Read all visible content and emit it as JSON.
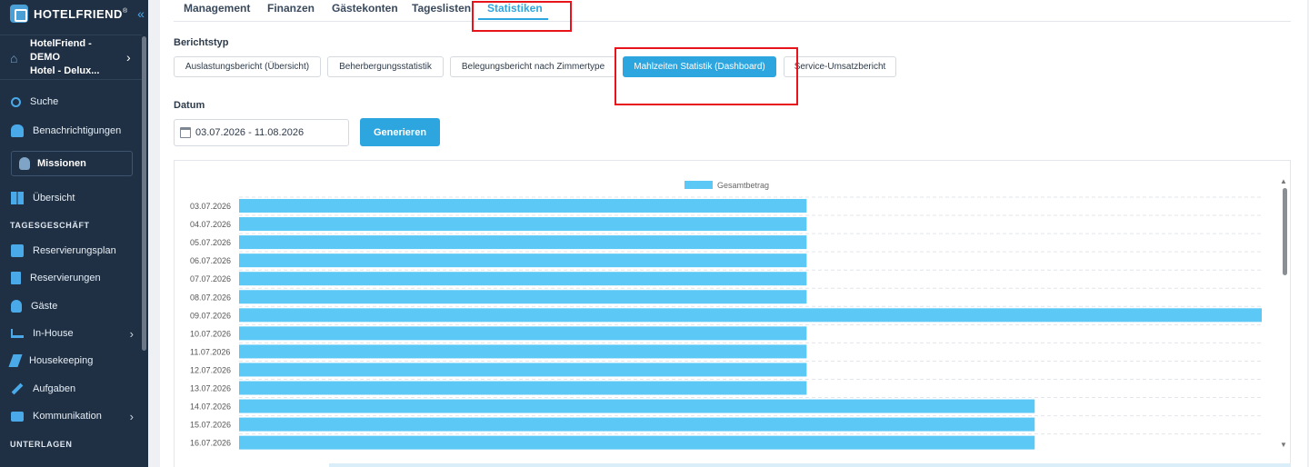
{
  "brand": {
    "name": "HOTELFRIEND",
    "registered": "®",
    "collapse_icon": "double-chevron-left-icon"
  },
  "hotel": {
    "line1": "HotelFriend - DEMO",
    "line2": "Hotel - Delux..."
  },
  "sidebar": {
    "items": [
      {
        "label": "Suche",
        "icon": "search-icon"
      },
      {
        "label": "Benachrichtigungen",
        "icon": "bell-icon"
      },
      {
        "label": "Missionen",
        "icon": "award-icon"
      },
      {
        "label": "Übersicht",
        "icon": "dashboard-icon"
      },
      {
        "label": "Reservierungsplan",
        "icon": "calendar-icon"
      },
      {
        "label": "Reservierungen",
        "icon": "document-icon"
      },
      {
        "label": "Gäste",
        "icon": "user-icon"
      },
      {
        "label": "In-House",
        "icon": "cart-icon"
      },
      {
        "label": "Housekeeping",
        "icon": "broom-icon"
      },
      {
        "label": "Aufgaben",
        "icon": "wrench-icon"
      },
      {
        "label": "Kommunikation",
        "icon": "chat-icon"
      }
    ],
    "section_tagesgeschaeft": "TAGESGESCHÄFT",
    "section_unterlagen": "UNTERLAGEN"
  },
  "tabs": [
    "Management",
    "Finanzen",
    "Gästekonten",
    "Tageslisten",
    "Statistiken"
  ],
  "active_tab": "Statistiken",
  "berichtstyp": {
    "label": "Berichtstyp",
    "options": [
      "Auslastungsbericht (Übersicht)",
      "Beherbergungsstatistik",
      "Belegungsbericht nach Zimmertype",
      "Mahlzeiten Statistik (Dashboard)",
      "Service-Umsatzbericht"
    ],
    "selected": "Mahlzeiten Statistik (Dashboard)"
  },
  "datum": {
    "label": "Datum",
    "value": "03.07.2026 - 11.08.2026"
  },
  "generate_label": "Generieren",
  "colors": {
    "accent": "#2da6e0",
    "bar": "#5bc8f5",
    "sidebar": "#1f3044",
    "highlight": "#e8141c"
  },
  "chart_data": {
    "type": "bar",
    "orientation": "horizontal",
    "legend": [
      "Gesamtbetrag"
    ],
    "legend_position": "top-center",
    "grid": true,
    "categories": [
      "03.07.2026",
      "04.07.2026",
      "05.07.2026",
      "06.07.2026",
      "07.07.2026",
      "08.07.2026",
      "09.07.2026",
      "10.07.2026",
      "11.07.2026",
      "12.07.2026",
      "13.07.2026",
      "14.07.2026",
      "15.07.2026",
      "16.07.2026"
    ],
    "series": [
      {
        "name": "Gesamtbetrag",
        "values": [
          0.555,
          0.555,
          0.555,
          0.555,
          0.555,
          0.555,
          1.0,
          0.555,
          0.555,
          0.555,
          0.555,
          0.778,
          0.778,
          0.778
        ]
      }
    ]
  }
}
